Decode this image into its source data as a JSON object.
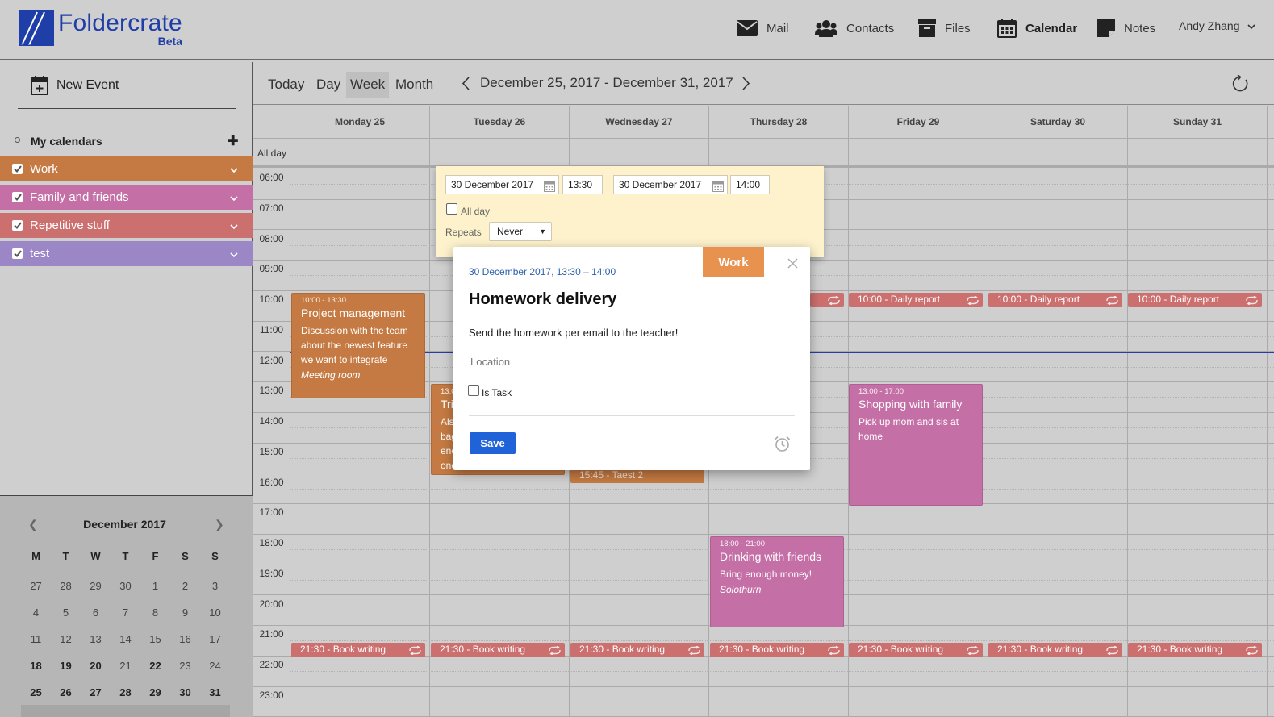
{
  "app": {
    "name": "Foldercrate",
    "badge": "Beta",
    "brand_color": "#1f3ea8"
  },
  "nav": [
    {
      "label": "Mail",
      "icon": "envelope-icon"
    },
    {
      "label": "Contacts",
      "icon": "people-icon"
    },
    {
      "label": "Files",
      "icon": "archive-box-icon"
    },
    {
      "label": "Calendar",
      "icon": "calendar-icon",
      "active": true
    },
    {
      "label": "Notes",
      "icon": "note-icon"
    }
  ],
  "user": {
    "name": "Andy Zhang"
  },
  "sidebar": {
    "new_event": "New Event",
    "my_calendars": "My calendars",
    "calendars": [
      {
        "label": "Work",
        "color": "#c47a42"
      },
      {
        "label": "Family and friends",
        "color": "#c46fa6"
      },
      {
        "label": "Repetitive stuff",
        "color": "#cc6f6f"
      },
      {
        "label": "test",
        "color": "#9b86c6"
      }
    ]
  },
  "mini_calendar": {
    "title": "December 2017",
    "weekdays": [
      "M",
      "T",
      "W",
      "T",
      "F",
      "S",
      "S"
    ],
    "weeks": [
      [
        "27",
        "28",
        "29",
        "30",
        "1",
        "2",
        "3"
      ],
      [
        "4",
        "5",
        "6",
        "7",
        "8",
        "9",
        "10"
      ],
      [
        "11",
        "12",
        "13",
        "14",
        "15",
        "16",
        "17"
      ],
      [
        "18",
        "19",
        "20",
        "21",
        "22",
        "23",
        "24"
      ],
      [
        "25",
        "26",
        "27",
        "28",
        "29",
        "30",
        "31"
      ]
    ]
  },
  "toolbar": {
    "today": "Today",
    "day": "Day",
    "week": "Week",
    "month": "Month",
    "range": "December 25, 2017 - December 31, 2017"
  },
  "week": {
    "days": [
      "Monday 25",
      "Tuesday 26",
      "Wednesday 27",
      "Thursday 28",
      "Friday 29",
      "Saturday 30",
      "Sunday 31"
    ],
    "all_day_label": "All day",
    "hours": [
      "06:00",
      "07:00",
      "08:00",
      "09:00",
      "10:00",
      "11:00",
      "12:00",
      "13:00",
      "14:00",
      "15:00",
      "16:00",
      "17:00",
      "18:00",
      "19:00",
      "20:00",
      "21:00",
      "22:00",
      "23:00"
    ]
  },
  "events": {
    "project": {
      "time": "10:00 - 13:30",
      "title": "Project management",
      "desc": "Discussion with the team about the newest feature we want to integrate",
      "location": "Meeting room"
    },
    "tue_partial": {
      "time": "13:0",
      "title": "Tri",
      "desc": "Als bag eno one"
    },
    "taest": {
      "label": "15:45 - Taest 2"
    },
    "shopping": {
      "time": "13:00 - 17:00",
      "title": "Shopping with family",
      "desc": "Pick up mom and sis at home"
    },
    "drinking": {
      "time": "18:00 - 21:00",
      "title": "Drinking with friends",
      "desc": "Bring enough money!",
      "location": "Solothurn"
    },
    "daily_report": "10:00 - Daily report",
    "book_writing": "21:30 - Book writing"
  },
  "editor": {
    "start_date": "30 December 2017",
    "start_time": "13:30",
    "end_date": "30 December 2017",
    "end_time": "14:00",
    "all_day_label": "All day",
    "repeats_label": "Repeats",
    "repeats_value": "Never"
  },
  "popup": {
    "tag": "Work",
    "datetime": "30 December 2017, 13:30 – 14:00",
    "title": "Homework delivery",
    "description": "Send the homework per email to the teacher!",
    "location_placeholder": "Location",
    "is_task_label": "Is Task",
    "save_label": "Save"
  }
}
